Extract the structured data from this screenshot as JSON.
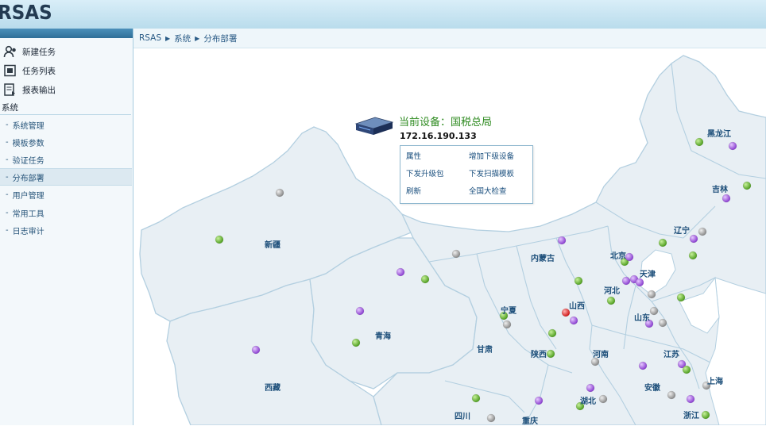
{
  "app": {
    "logo": "RSAS"
  },
  "sidebar": {
    "top_items": [
      {
        "label": "新建任务",
        "icon": "users-icon"
      },
      {
        "label": "任务列表",
        "icon": "task-list-icon"
      },
      {
        "label": "报表输出",
        "icon": "report-export-icon"
      }
    ],
    "group_title": "系统",
    "sub_items": [
      {
        "label": "系统管理"
      },
      {
        "label": "模板参数"
      },
      {
        "label": "验证任务"
      },
      {
        "label": "分布部署",
        "active": true
      },
      {
        "label": "用户管理"
      },
      {
        "label": "常用工具"
      },
      {
        "label": "日志审计"
      }
    ]
  },
  "breadcrumb": [
    "RSAS",
    "系统",
    "分布部署"
  ],
  "device": {
    "title": "当前设备：国税总局",
    "ip": "172.16.190.133",
    "menu": [
      "属性",
      "增加下级设备",
      "下发升级包",
      "下发扫描模板",
      "刷新",
      "全国大检查"
    ]
  },
  "map": {
    "provinces": [
      "黑龙江",
      "吉林",
      "辽宁",
      "内蒙古",
      "北京",
      "天津",
      "河北",
      "山西",
      "山东",
      "宁夏",
      "甘肃",
      "陕西",
      "河南",
      "江苏",
      "上海",
      "安徽",
      "湖北",
      "浙江",
      "四川",
      "重庆",
      "新疆",
      "青海",
      "西藏"
    ],
    "node_colors": {
      "green": "#5fb231",
      "purple": "#a259e0",
      "gray": "#9a9a9a",
      "red": "#e02a2a"
    }
  }
}
